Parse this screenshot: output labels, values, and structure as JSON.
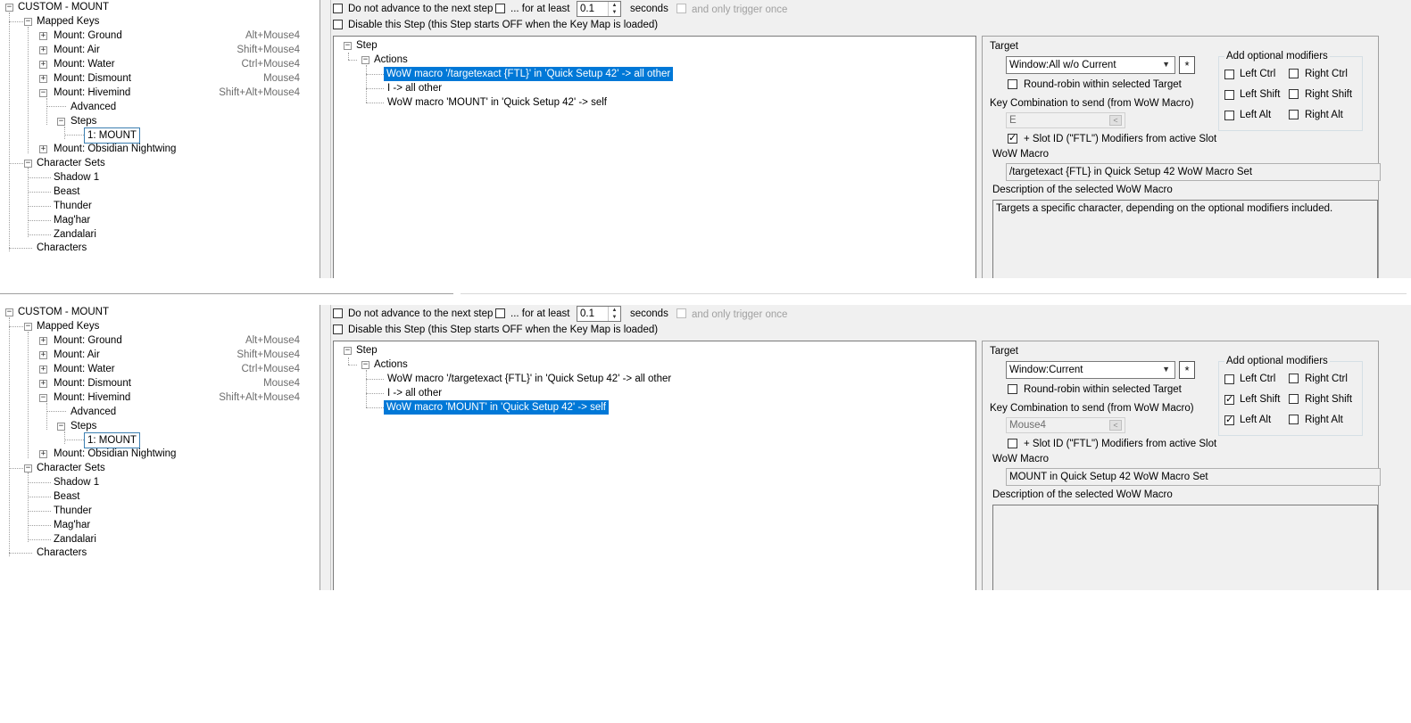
{
  "panels": [
    {
      "tree": {
        "root": "CUSTOM - MOUNT",
        "mapped_keys": "Mapped Keys",
        "keys": [
          {
            "label": "Mount: Ground",
            "hotkey": "Alt+Mouse4"
          },
          {
            "label": "Mount: Air",
            "hotkey": "Shift+Mouse4"
          },
          {
            "label": "Mount: Water",
            "hotkey": "Ctrl+Mouse4"
          },
          {
            "label": "Mount: Dismount",
            "hotkey": "Mouse4"
          },
          {
            "label": "Mount: Hivemind",
            "hotkey": "Shift+Alt+Mouse4"
          }
        ],
        "advanced": "Advanced",
        "steps": "Steps",
        "step_item": "1: MOUNT",
        "obsidian": "Mount: Obsidian Nightwing",
        "character_sets": "Character Sets",
        "sets": [
          "Shadow 1",
          "Beast",
          "Thunder",
          "Mag'har",
          "Zandalari"
        ],
        "characters": "Characters"
      },
      "options": {
        "no_advance": "Do not advance to the next step",
        "for_at_least": "... for at least",
        "seconds_value": "0.1",
        "seconds": "seconds",
        "trigger_once": "and only trigger once",
        "disable_step": "Disable this Step (this Step starts OFF when the Key Map is loaded)"
      },
      "step_tree": {
        "step": "Step",
        "actions": "Actions",
        "items": [
          "WoW macro '/targetexact {FTL}' in 'Quick Setup 42' -> all other",
          "I -> all other",
          "WoW macro 'MOUNT' in 'Quick Setup 42' -> self"
        ],
        "selected_index": 0
      },
      "target": {
        "label": "Target",
        "value": "Window:All w/o Current",
        "star": "*",
        "round_robin": "Round-robin within selected Target",
        "key_combo_label": "Key Combination to send (from WoW Macro)",
        "key_value": "E",
        "key_btn": "<",
        "slot_id": "+ Slot ID (\"FTL\") Modifiers from active Slot",
        "slot_checked": true,
        "macro_label": "WoW Macro",
        "macro_value": "/targetexact {FTL} in Quick Setup 42 WoW Macro Set",
        "desc_label": "Description of the selected WoW Macro",
        "desc_value": "Targets a specific character, depending on the optional modifiers included."
      },
      "modifiers": {
        "title": "Add optional modifiers",
        "left_ctrl": {
          "label": "Left Ctrl",
          "checked": false
        },
        "right_ctrl": {
          "label": "Right Ctrl",
          "checked": false
        },
        "left_shift": {
          "label": "Left Shift",
          "checked": false
        },
        "right_shift": {
          "label": "Right Shift",
          "checked": false
        },
        "left_alt": {
          "label": "Left Alt",
          "checked": false
        },
        "right_alt": {
          "label": "Right Alt",
          "checked": false
        }
      }
    },
    {
      "tree": {
        "root": "CUSTOM - MOUNT",
        "mapped_keys": "Mapped Keys",
        "keys": [
          {
            "label": "Mount: Ground",
            "hotkey": "Alt+Mouse4"
          },
          {
            "label": "Mount: Air",
            "hotkey": "Shift+Mouse4"
          },
          {
            "label": "Mount: Water",
            "hotkey": "Ctrl+Mouse4"
          },
          {
            "label": "Mount: Dismount",
            "hotkey": "Mouse4"
          },
          {
            "label": "Mount: Hivemind",
            "hotkey": "Shift+Alt+Mouse4"
          }
        ],
        "advanced": "Advanced",
        "steps": "Steps",
        "step_item": "1: MOUNT",
        "obsidian": "Mount: Obsidian Nightwing",
        "character_sets": "Character Sets",
        "sets": [
          "Shadow 1",
          "Beast",
          "Thunder",
          "Mag'har",
          "Zandalari"
        ],
        "characters": "Characters"
      },
      "options": {
        "no_advance": "Do not advance to the next step",
        "for_at_least": "... for at least",
        "seconds_value": "0.1",
        "seconds": "seconds",
        "trigger_once": "and only trigger once",
        "disable_step": "Disable this Step (this Step starts OFF when the Key Map is loaded)"
      },
      "step_tree": {
        "step": "Step",
        "actions": "Actions",
        "items": [
          "WoW macro '/targetexact {FTL}' in 'Quick Setup 42' -> all other",
          "I -> all other",
          "WoW macro 'MOUNT' in 'Quick Setup 42' -> self"
        ],
        "selected_index": 2
      },
      "target": {
        "label": "Target",
        "value": "Window:Current",
        "star": "*",
        "round_robin": "Round-robin within selected Target",
        "key_combo_label": "Key Combination to send (from WoW Macro)",
        "key_value": "Mouse4",
        "key_btn": "<",
        "slot_id": "+ Slot ID (\"FTL\") Modifiers from active Slot",
        "slot_checked": false,
        "macro_label": "WoW Macro",
        "macro_value": "MOUNT in Quick Setup 42 WoW Macro Set",
        "desc_label": "Description of the selected WoW Macro",
        "desc_value": ""
      },
      "modifiers": {
        "title": "Add optional modifiers",
        "left_ctrl": {
          "label": "Left Ctrl",
          "checked": false
        },
        "right_ctrl": {
          "label": "Right Ctrl",
          "checked": false
        },
        "left_shift": {
          "label": "Left Shift",
          "checked": true
        },
        "right_shift": {
          "label": "Right Shift",
          "checked": false
        },
        "left_alt": {
          "label": "Left Alt",
          "checked": true
        },
        "right_alt": {
          "label": "Right Alt",
          "checked": false
        }
      }
    }
  ],
  "colors": {
    "selection": "#0078d7",
    "window_bg": "#f0f0f0",
    "hotkey_text": "#6d6d6d"
  }
}
